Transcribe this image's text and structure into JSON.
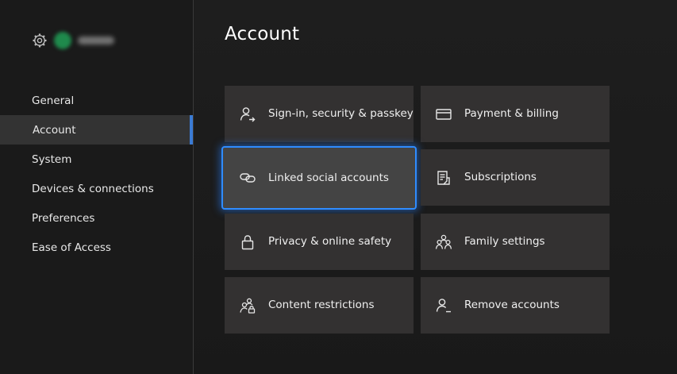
{
  "sidebar": {
    "profile": {
      "gamertag": ""
    },
    "items": [
      {
        "label": "General"
      },
      {
        "label": "Account"
      },
      {
        "label": "System"
      },
      {
        "label": "Devices & connections"
      },
      {
        "label": "Preferences"
      },
      {
        "label": "Ease of Access"
      }
    ],
    "selected_index": 1
  },
  "main": {
    "title": "Account",
    "tiles": [
      {
        "label": "Sign-in, security & passkey",
        "icon": "person-arrow-icon"
      },
      {
        "label": "Payment & billing",
        "icon": "credit-card-icon"
      },
      {
        "label": "Linked social accounts",
        "icon": "linked-chain-icon"
      },
      {
        "label": "Subscriptions",
        "icon": "document-list-icon"
      },
      {
        "label": "Privacy & online safety",
        "icon": "lock-icon"
      },
      {
        "label": "Family settings",
        "icon": "family-icon"
      },
      {
        "label": "Content restrictions",
        "icon": "people-lock-icon"
      },
      {
        "label": "Remove accounts",
        "icon": "person-remove-icon"
      }
    ],
    "focused_index": 2
  },
  "colors": {
    "background": "#1c1c1c",
    "tile": "#333131",
    "tile_focused": "#444444",
    "focus_ring": "#2f8cff",
    "nav_indicator": "#3b7bd4",
    "avatar": "#1f8a4c"
  }
}
